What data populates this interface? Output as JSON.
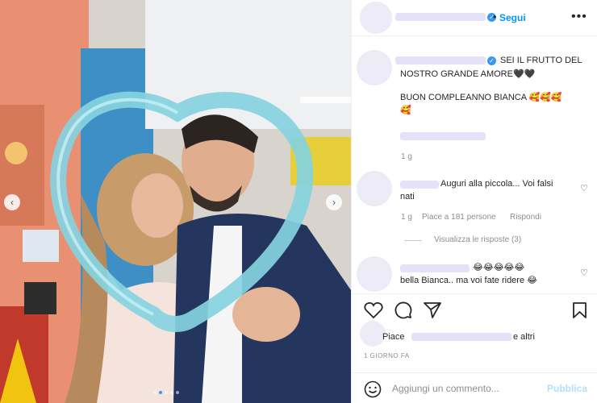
{
  "post": {
    "carousel": {
      "dot_count": 5,
      "active_dot": 1
    },
    "header": {
      "follow_label": "Segui",
      "dot": "•",
      "more": "•••"
    },
    "caption": {
      "line1": "SEI IL FRUTTO DEL",
      "line2": "NOSTRO GRANDE AMORE🖤🖤",
      "line3": "BUON COMPLEANNO BIANCA 🥰🥰🥰",
      "line4": "🥰",
      "time": "1 g"
    },
    "comments": [
      {
        "text_line1": "Auguri alla piccola... Voi falsi",
        "text_line2": "nati",
        "time": "1 g",
        "likes": "Piace a 181 persone",
        "reply": "Rispondi",
        "view_replies": "Visualizza le risposte (3)"
      },
      {
        "text_line1": "😂😂😂😂😂",
        "text_line2": "bella Bianca.. ma voi fate ridere 😂"
      }
    ],
    "likes_prefix": "Piace",
    "likes_suffix": "e altri",
    "date": "1 GIORNO FA",
    "add_comment_placeholder": "Aggiungi un commento...",
    "publish_label": "Pubblica"
  }
}
